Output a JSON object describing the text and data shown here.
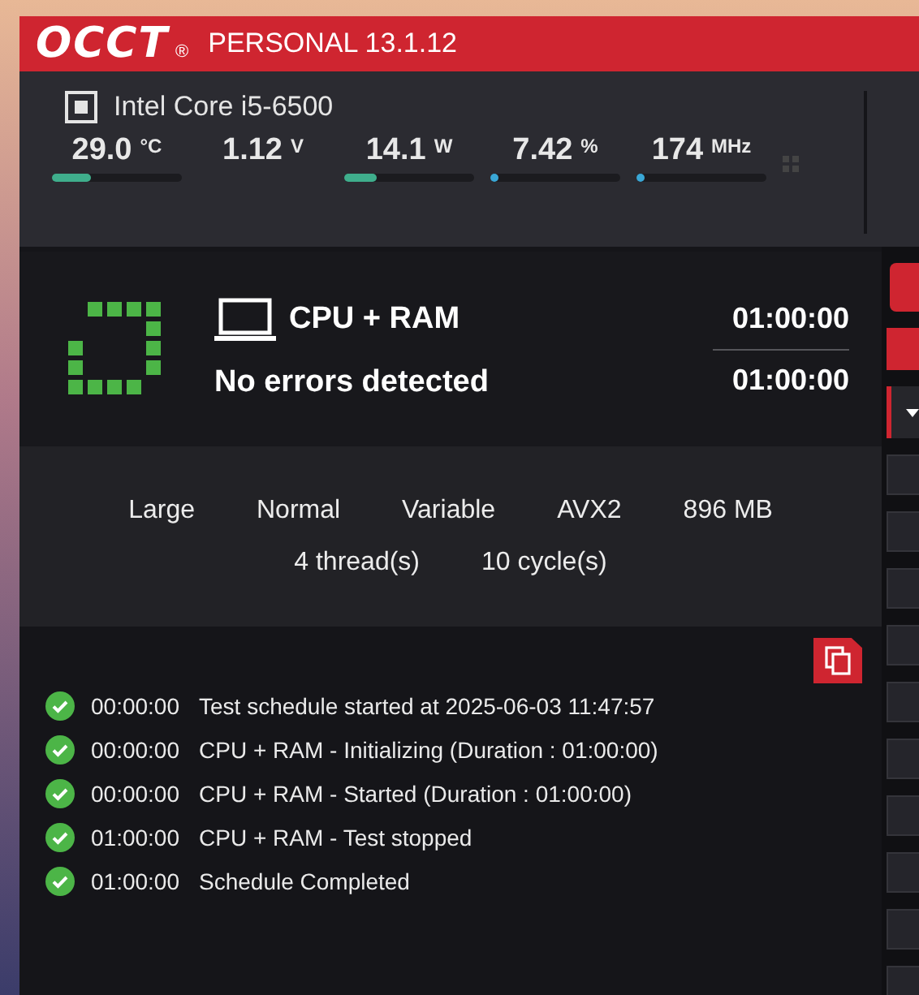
{
  "header": {
    "logo": "OCCT",
    "registered": "®",
    "edition": "PERSONAL 13.1.12"
  },
  "sensors": {
    "device": "Intel Core i5-6500",
    "readings": [
      {
        "value": "29.0",
        "unit": "°C",
        "level": 0.3
      },
      {
        "value": "1.12",
        "unit": "V"
      },
      {
        "value": "14.1",
        "unit": "W",
        "level": 0.25
      },
      {
        "value": "7.42",
        "unit": "%",
        "level": 0.02
      },
      {
        "value": "174",
        "unit": "MHz",
        "level": 0.02
      }
    ]
  },
  "test": {
    "name": "CPU + RAM",
    "status": "No errors detected",
    "elapsed": "01:00:00",
    "duration": "01:00:00"
  },
  "settings": {
    "row_1": [
      "Large",
      "Normal",
      "Variable",
      "AVX2",
      "896 MB"
    ],
    "row_2": [
      "4 thread(s)",
      "10 cycle(s)"
    ]
  },
  "log": [
    {
      "time": "00:00:00",
      "message": "Test schedule started at 2025-06-03 11:47:57"
    },
    {
      "time": "00:00:00",
      "message": "CPU + RAM - Initializing (Duration : 01:00:00)"
    },
    {
      "time": "00:00:00",
      "message": "CPU + RAM - Started (Duration : 01:00:00)"
    },
    {
      "time": "01:00:00",
      "message": "CPU + RAM - Test stopped"
    },
    {
      "time": "01:00:00",
      "message": "Schedule Completed"
    }
  ]
}
